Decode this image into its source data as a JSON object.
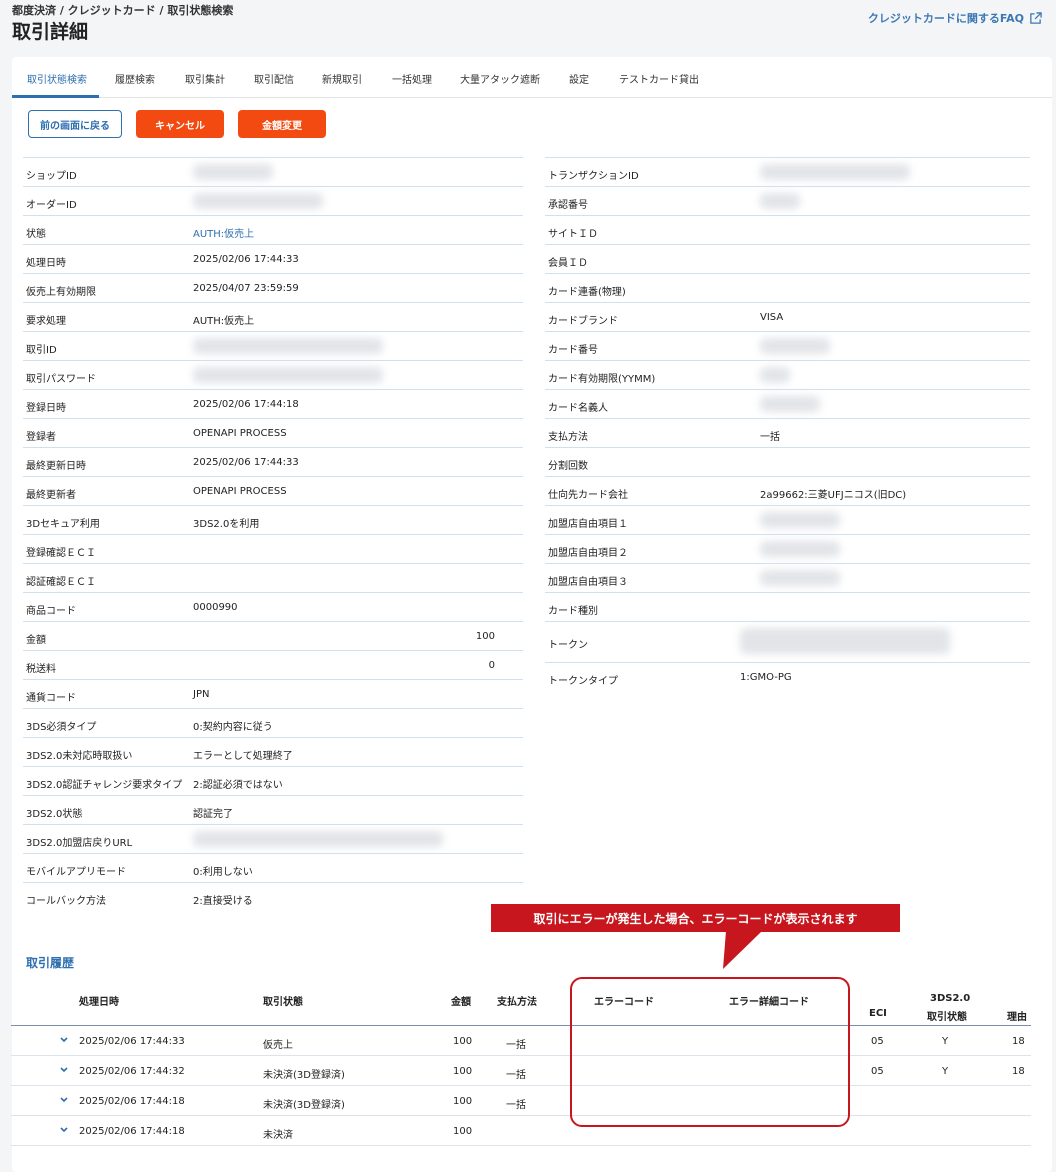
{
  "header": {
    "breadcrumb": "都度決済 / クレジットカード / 取引状態検索",
    "title": "取引詳細",
    "faq_label": "クレジットカードに関するFAQ"
  },
  "tabs": [
    {
      "label": "取引状態検索",
      "active": true
    },
    {
      "label": "履歴検索"
    },
    {
      "label": "取引集計"
    },
    {
      "label": "取引配信"
    },
    {
      "label": "新規取引"
    },
    {
      "label": "一括処理"
    },
    {
      "label": "大量アタック遮断"
    },
    {
      "label": "設定"
    },
    {
      "label": "テストカード貸出"
    }
  ],
  "buttons": {
    "back": "前の画面に戻る",
    "cancel": "キャンセル",
    "change_amount": "金額変更"
  },
  "details_left": [
    {
      "label": "ショップID",
      "value": ""
    },
    {
      "label": "オーダーID",
      "value": ""
    },
    {
      "label": "状態",
      "value": "AUTH:仮売上"
    },
    {
      "label": "処理日時",
      "value": "2025/02/06 17:44:33"
    },
    {
      "label": "仮売上有効期限",
      "value": "2025/04/07 23:59:59"
    },
    {
      "label": "要求処理",
      "value": "AUTH:仮売上"
    },
    {
      "label": "取引ID",
      "value": ""
    },
    {
      "label": "取引パスワード",
      "value": ""
    },
    {
      "label": "登録日時",
      "value": "2025/02/06 17:44:18"
    },
    {
      "label": "登録者",
      "value": "OPENAPI PROCESS"
    },
    {
      "label": "最終更新日時",
      "value": "2025/02/06 17:44:33"
    },
    {
      "label": "最終更新者",
      "value": "OPENAPI PROCESS"
    },
    {
      "label": "3Dセキュア利用",
      "value": "3DS2.0を利用"
    },
    {
      "label": "登録確認ＥＣＩ",
      "value": ""
    },
    {
      "label": "認証確認ＥＣＩ",
      "value": ""
    },
    {
      "label": "商品コード",
      "value": "0000990"
    },
    {
      "label": "金額",
      "value": "100"
    },
    {
      "label": "税送料",
      "value": "0"
    },
    {
      "label": "通貨コード",
      "value": "JPN"
    },
    {
      "label": "3DS必須タイプ",
      "value": "0:契約内容に従う"
    },
    {
      "label": "3DS2.0未対応時取扱い",
      "value": "エラーとして処理終了"
    },
    {
      "label": "3DS2.0認証チャレンジ要求タイプ",
      "value": "2:認証必須ではない"
    },
    {
      "label": "3DS2.0状態",
      "value": "認証完了"
    },
    {
      "label": "3DS2.0加盟店戻りURL",
      "value": ""
    },
    {
      "label": "モバイルアプリモード",
      "value": "0:利用しない"
    },
    {
      "label": "コールバック方法",
      "value": "2:直接受ける"
    }
  ],
  "details_right": [
    {
      "label": "トランザクションID",
      "value": ""
    },
    {
      "label": "承認番号",
      "value": ""
    },
    {
      "label": "サイトＩＤ",
      "value": ""
    },
    {
      "label": "会員ＩＤ",
      "value": ""
    },
    {
      "label": "カード連番(物理)",
      "value": ""
    },
    {
      "label": "カードブランド",
      "value": "VISA"
    },
    {
      "label": "カード番号",
      "value": ""
    },
    {
      "label": "カード有効期限(YYMM)",
      "value": ""
    },
    {
      "label": "カード名義人",
      "value": ""
    },
    {
      "label": "支払方法",
      "value": "一括"
    },
    {
      "label": "分割回数",
      "value": ""
    },
    {
      "label": "仕向先カード会社",
      "value": "2a99662:三菱UFJニコス(旧DC)"
    },
    {
      "label": "加盟店自由項目１",
      "value": ""
    },
    {
      "label": "加盟店自由項目２",
      "value": ""
    },
    {
      "label": "加盟店自由項目３",
      "value": ""
    },
    {
      "label": "カード種別",
      "value": ""
    },
    {
      "label": "トークン",
      "value": ""
    },
    {
      "label": "トークンタイプ",
      "value": "1:GMO-PG"
    }
  ],
  "history": {
    "title": "取引履歴",
    "headers": {
      "date": "処理日時",
      "status": "取引状態",
      "amount": "金額",
      "method": "支払方法",
      "error_code": "エラーコード",
      "error_detail": "エラー詳細コード",
      "eci": "ECI",
      "tds_line1": "3DS2.0",
      "tds_line2": "取引状態",
      "reason": "理由"
    },
    "rows": [
      {
        "date": "2025/02/06 17:44:33",
        "status": "仮売上",
        "amount": "100",
        "method": "一括",
        "eci": "05",
        "tds": "Y",
        "reason": "18"
      },
      {
        "date": "2025/02/06 17:44:32",
        "status": "未決済(3D登録済)",
        "amount": "100",
        "method": "一括",
        "eci": "05",
        "tds": "Y",
        "reason": "18"
      },
      {
        "date": "2025/02/06 17:44:18",
        "status": "未決済(3D登録済)",
        "amount": "100",
        "method": "一括",
        "eci": "",
        "tds": "",
        "reason": ""
      },
      {
        "date": "2025/02/06 17:44:18",
        "status": "未決済",
        "amount": "100",
        "method": "",
        "eci": "",
        "tds": "",
        "reason": ""
      }
    ]
  },
  "annotation": {
    "callout": "取引にエラーが発生した場合、エラーコードが表示されます",
    "color": "#c7161d"
  }
}
